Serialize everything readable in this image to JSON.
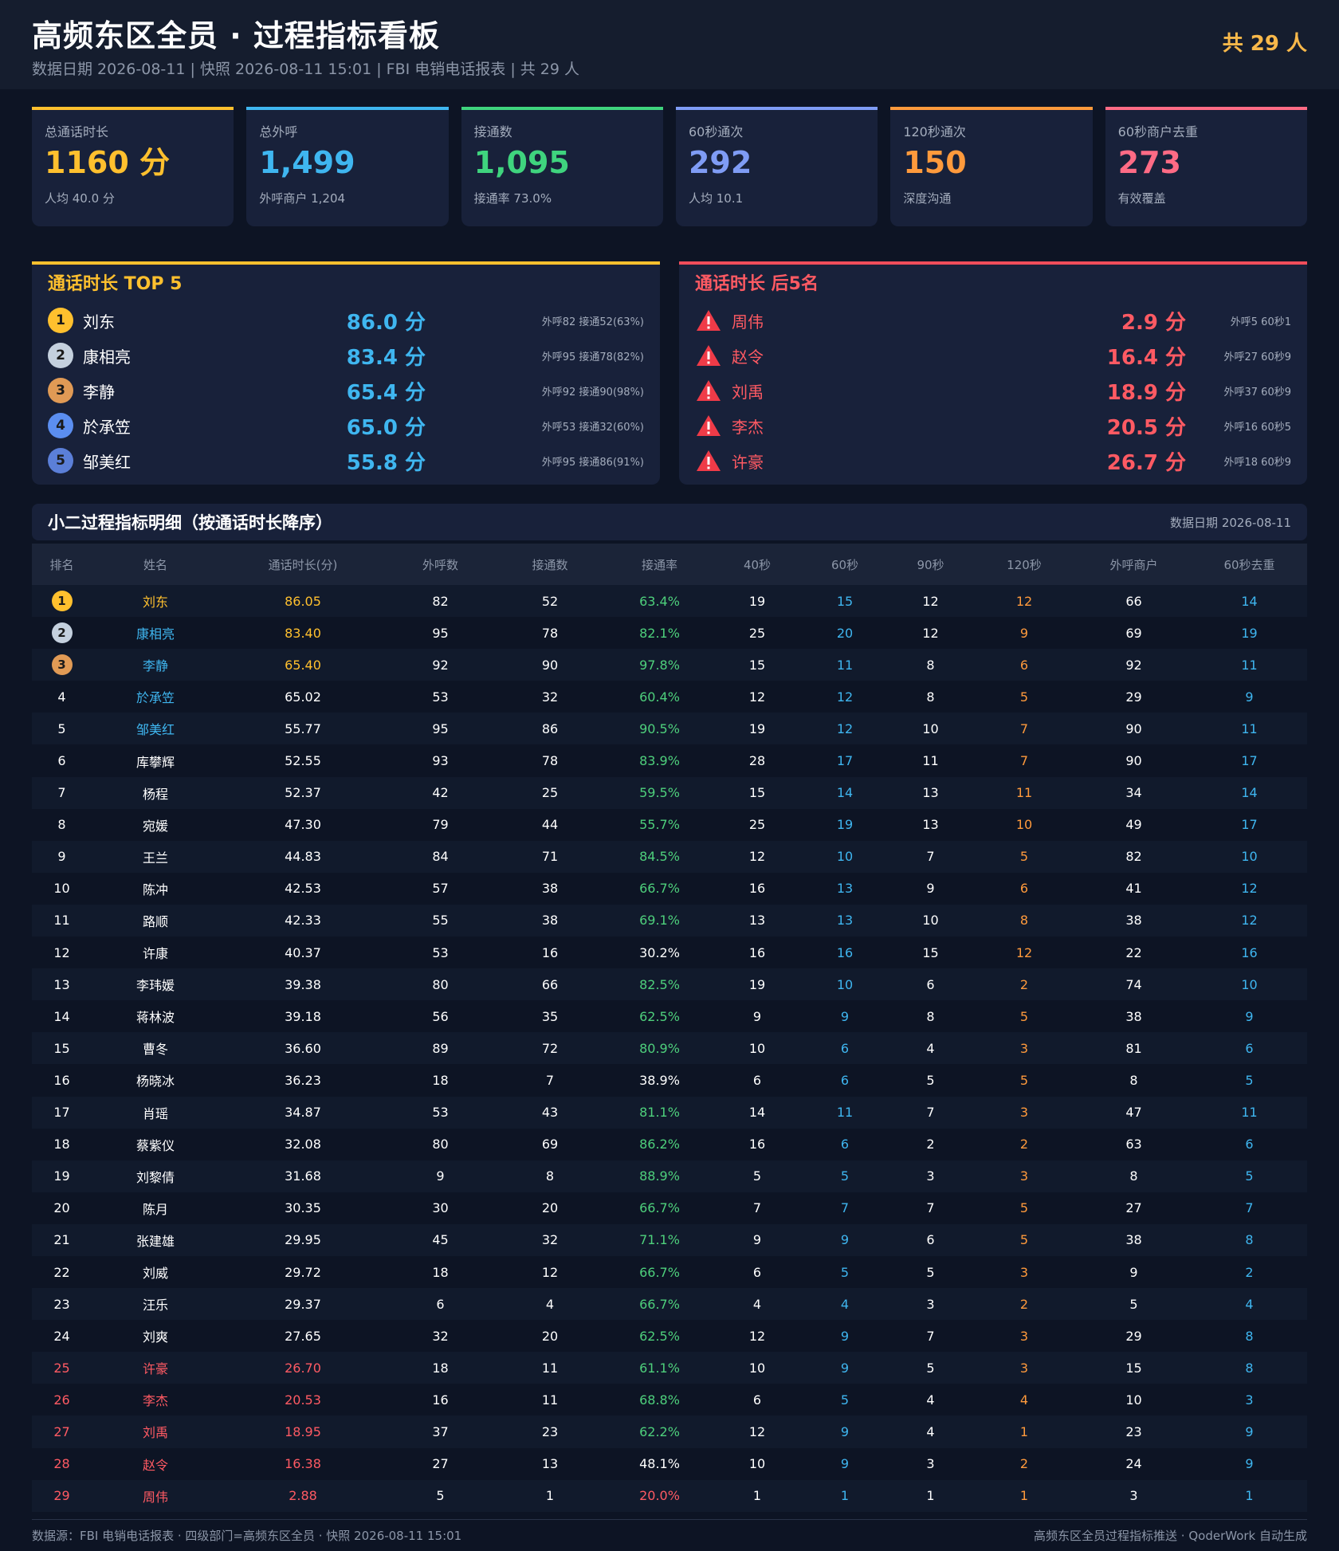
{
  "header": {
    "title": "高频东区全员 · 过程指标看板",
    "subtitle": "数据日期 2026-08-11 | 快照 2026-08-11 15:01 | FBI 电销电话报表 | 共 29 人",
    "total": "共 29 人"
  },
  "kpis": [
    {
      "label": "总通话时长",
      "value": "1160 分",
      "note": "人均 40.0 分",
      "color": "#ffc02e"
    },
    {
      "label": "总外呼",
      "value": "1,499",
      "note": "外呼商户 1,204",
      "color": "#3fb6f0"
    },
    {
      "label": "接通数",
      "value": "1,095",
      "note": "接通率 73.0%",
      "color": "#3fd47e"
    },
    {
      "label": "60秒通次",
      "value": "292",
      "note": "人均 10.1",
      "color": "#7f9cf5"
    },
    {
      "label": "120秒通次",
      "value": "150",
      "note": "深度沟通",
      "color": "#ff9a3c"
    },
    {
      "label": "60秒商户去重",
      "value": "273",
      "note": "有效覆盖",
      "color": "#ff6b85"
    }
  ],
  "top5": {
    "title": "通话时长 TOP 5",
    "items": [
      {
        "rank": "1",
        "name": "刘东",
        "value": "86.0 分",
        "info": "外呼82 接通52(63%)",
        "color": "#ffc02e"
      },
      {
        "rank": "2",
        "name": "康相亮",
        "value": "83.4 分",
        "info": "外呼95 接通78(82%)",
        "color": "#c4d0de"
      },
      {
        "rank": "3",
        "name": "李静",
        "value": "65.4 分",
        "info": "外呼92 接通90(98%)",
        "color": "#e09a55"
      },
      {
        "rank": "4",
        "name": "於承笠",
        "value": "65.0 分",
        "info": "外呼53 接通32(60%)",
        "color": "#5b8ef0"
      },
      {
        "rank": "5",
        "name": "邹美红",
        "value": "55.8 分",
        "info": "外呼95 接通86(91%)",
        "color": "#5b7fd8"
      }
    ]
  },
  "bottom5": {
    "title": "通话时长 后5名",
    "items": [
      {
        "name": "周伟",
        "value": "2.9 分",
        "info": "外呼5 60秒1"
      },
      {
        "name": "赵令",
        "value": "16.4 分",
        "info": "外呼27 60秒9"
      },
      {
        "name": "刘禹",
        "value": "18.9 分",
        "info": "外呼37 60秒9"
      },
      {
        "name": "李杰",
        "value": "20.5 分",
        "info": "外呼16 60秒5"
      },
      {
        "name": "许豪",
        "value": "26.7 分",
        "info": "外呼18 60秒9"
      }
    ]
  },
  "detail": {
    "title": "小二过程指标明细（按通话时长降序）",
    "date": "数据日期 2026-08-11",
    "columns": [
      "排名",
      "姓名",
      "通话时长(分)",
      "外呼数",
      "接通数",
      "接通率",
      "40秒",
      "60秒",
      "90秒",
      "120秒",
      "外呼商户",
      "60秒去重"
    ],
    "rows": [
      [
        "1",
        "刘东",
        "86.05",
        "82",
        "52",
        "63.4%",
        "19",
        "15",
        "12",
        "12",
        "66",
        "14"
      ],
      [
        "2",
        "康相亮",
        "83.40",
        "95",
        "78",
        "82.1%",
        "25",
        "20",
        "12",
        "9",
        "69",
        "19"
      ],
      [
        "3",
        "李静",
        "65.40",
        "92",
        "90",
        "97.8%",
        "15",
        "11",
        "8",
        "6",
        "92",
        "11"
      ],
      [
        "4",
        "於承笠",
        "65.02",
        "53",
        "32",
        "60.4%",
        "12",
        "12",
        "8",
        "5",
        "29",
        "9"
      ],
      [
        "5",
        "邹美红",
        "55.77",
        "95",
        "86",
        "90.5%",
        "19",
        "12",
        "10",
        "7",
        "90",
        "11"
      ],
      [
        "6",
        "库攀辉",
        "52.55",
        "93",
        "78",
        "83.9%",
        "28",
        "17",
        "11",
        "7",
        "90",
        "17"
      ],
      [
        "7",
        "杨程",
        "52.37",
        "42",
        "25",
        "59.5%",
        "15",
        "14",
        "13",
        "11",
        "34",
        "14"
      ],
      [
        "8",
        "宛媛",
        "47.30",
        "79",
        "44",
        "55.7%",
        "25",
        "19",
        "13",
        "10",
        "49",
        "17"
      ],
      [
        "9",
        "王兰",
        "44.83",
        "84",
        "71",
        "84.5%",
        "12",
        "10",
        "7",
        "5",
        "82",
        "10"
      ],
      [
        "10",
        "陈冲",
        "42.53",
        "57",
        "38",
        "66.7%",
        "16",
        "13",
        "9",
        "6",
        "41",
        "12"
      ],
      [
        "11",
        "路顺",
        "42.33",
        "55",
        "38",
        "69.1%",
        "13",
        "13",
        "10",
        "8",
        "38",
        "12"
      ],
      [
        "12",
        "许康",
        "40.37",
        "53",
        "16",
        "30.2%",
        "16",
        "16",
        "15",
        "12",
        "22",
        "16"
      ],
      [
        "13",
        "李玮媛",
        "39.38",
        "80",
        "66",
        "82.5%",
        "19",
        "10",
        "6",
        "2",
        "74",
        "10"
      ],
      [
        "14",
        "蒋林波",
        "39.18",
        "56",
        "35",
        "62.5%",
        "9",
        "9",
        "8",
        "5",
        "38",
        "9"
      ],
      [
        "15",
        "曹冬",
        "36.60",
        "89",
        "72",
        "80.9%",
        "10",
        "6",
        "4",
        "3",
        "81",
        "6"
      ],
      [
        "16",
        "杨晓冰",
        "36.23",
        "18",
        "7",
        "38.9%",
        "6",
        "6",
        "5",
        "5",
        "8",
        "5"
      ],
      [
        "17",
        "肖瑶",
        "34.87",
        "53",
        "43",
        "81.1%",
        "14",
        "11",
        "7",
        "3",
        "47",
        "11"
      ],
      [
        "18",
        "蔡紫仪",
        "32.08",
        "80",
        "69",
        "86.2%",
        "16",
        "6",
        "2",
        "2",
        "63",
        "6"
      ],
      [
        "19",
        "刘黎倩",
        "31.68",
        "9",
        "8",
        "88.9%",
        "5",
        "5",
        "3",
        "3",
        "8",
        "5"
      ],
      [
        "20",
        "陈月",
        "30.35",
        "30",
        "20",
        "66.7%",
        "7",
        "7",
        "7",
        "5",
        "27",
        "7"
      ],
      [
        "21",
        "张建雄",
        "29.95",
        "45",
        "32",
        "71.1%",
        "9",
        "9",
        "6",
        "5",
        "38",
        "8"
      ],
      [
        "22",
        "刘威",
        "29.72",
        "18",
        "12",
        "66.7%",
        "6",
        "5",
        "5",
        "3",
        "9",
        "2"
      ],
      [
        "23",
        "汪乐",
        "29.37",
        "6",
        "4",
        "66.7%",
        "4",
        "4",
        "3",
        "2",
        "5",
        "4"
      ],
      [
        "24",
        "刘爽",
        "27.65",
        "32",
        "20",
        "62.5%",
        "12",
        "9",
        "7",
        "3",
        "29",
        "8"
      ],
      [
        "25",
        "许豪",
        "26.70",
        "18",
        "11",
        "61.1%",
        "10",
        "9",
        "5",
        "3",
        "15",
        "8"
      ],
      [
        "26",
        "李杰",
        "20.53",
        "16",
        "11",
        "68.8%",
        "6",
        "5",
        "4",
        "4",
        "10",
        "3"
      ],
      [
        "27",
        "刘禹",
        "18.95",
        "37",
        "23",
        "62.2%",
        "12",
        "9",
        "4",
        "1",
        "23",
        "9"
      ],
      [
        "28",
        "赵令",
        "16.38",
        "27",
        "13",
        "48.1%",
        "10",
        "9",
        "3",
        "2",
        "24",
        "9"
      ],
      [
        "29",
        "周伟",
        "2.88",
        "5",
        "1",
        "20.0%",
        "1",
        "1",
        "1",
        "1",
        "3",
        "1"
      ]
    ]
  },
  "footer": {
    "left": "数据源：FBI 电销电话报表 · 四级部门=高频东区全员 · 快照 2026-08-11 15:01",
    "right": "高频东区全员过程指标推送 · QoderWork 自动生成"
  },
  "colors": {
    "gold": "#ffc02e",
    "blue": "#3fb6f0",
    "green": "#4ed07c",
    "orange": "#ff9a3c",
    "red": "#ff5a63"
  }
}
